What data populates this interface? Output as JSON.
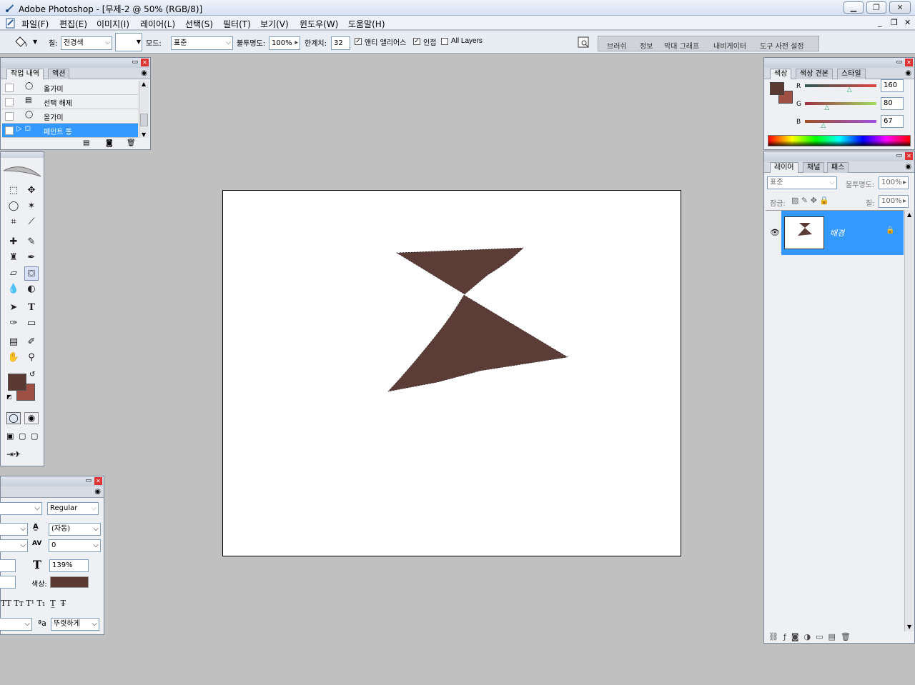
{
  "window": {
    "title": "Adobe Photoshop - [무제-2 @ 50% (RGB/8)]"
  },
  "menu": [
    "파일(F)",
    "편집(E)",
    "이미지(I)",
    "레이어(L)",
    "선택(S)",
    "필터(T)",
    "보기(V)",
    "윈도우(W)",
    "도움말(H)"
  ],
  "options": {
    "fill_label": "칠:",
    "fill_value": "전경색",
    "mode_label": "모드:",
    "mode_value": "표준",
    "opacity_label": "불투명도:",
    "opacity_value": "100%",
    "tolerance_label": "한계치:",
    "tolerance_value": "32",
    "antialias_label": "앤티 앨리어스",
    "antialias_checked": true,
    "contiguous_label": "인접",
    "contiguous_checked": true,
    "all_layers_label": "All Layers",
    "all_layers_checked": false
  },
  "palette_well": [
    "브러쉬",
    "정보",
    "막대 그래프",
    "내비게이터",
    "도구 사전 설정"
  ],
  "history": {
    "tabs": [
      "작업 내역",
      "액션"
    ],
    "items": [
      {
        "label": "올가미",
        "selected": false
      },
      {
        "label": "선택 해제",
        "selected": false
      },
      {
        "label": "올가미",
        "selected": false
      },
      {
        "label": "페인트 통",
        "selected": true
      }
    ]
  },
  "color_panel": {
    "tabs": [
      "색상",
      "색상 견본",
      "스타일"
    ],
    "channels": [
      {
        "name": "R",
        "value": "160",
        "fraction": 0.627
      },
      {
        "name": "G",
        "value": "80",
        "fraction": 0.314
      },
      {
        "name": "B",
        "value": "67",
        "fraction": 0.263
      }
    ],
    "foreground": "#5a3a33",
    "background": "#a05043"
  },
  "layers_panel": {
    "tabs": [
      "레이어",
      "채널",
      "패스"
    ],
    "blend_mode": "표준",
    "opacity_label": "불투명도:",
    "opacity_value": "100%",
    "lock_label": "잠금:",
    "fill_label": "칠:",
    "fill_value": "100%",
    "layers": [
      {
        "name": "배경",
        "visible": true,
        "locked": true,
        "selected": true
      }
    ]
  },
  "character_panel": {
    "font_style": "Regular",
    "leading": "(자동)",
    "kerning": "0",
    "scale": "139%",
    "color_label": "색상:",
    "color": "#5b3a33",
    "antialias": "뚜렷하게"
  },
  "colors": {
    "accent": "#3399ff",
    "selection": "#3399ff",
    "shape": "#5b3c36"
  }
}
